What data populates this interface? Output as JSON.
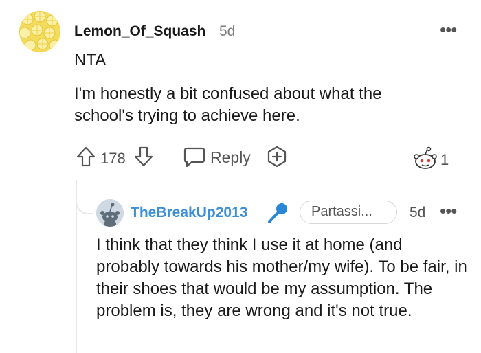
{
  "comment": {
    "username": "Lemon_Of_Squash",
    "time": "5d",
    "lines": [
      "NTA",
      "I'm honestly a bit confused about what the",
      "school's trying to achieve here."
    ],
    "votes": "178",
    "reply_label": "Reply",
    "award_count": "1",
    "more": "•••"
  },
  "reply": {
    "username": "TheBreakUp2013",
    "flair": "Partassi...",
    "time": "5d",
    "more": "•••",
    "text": "I think that they think I use it at home (and probably towards his mother/my wife). To be fair, in their shoes that would be my assumption. The problem is, they are wrong and it's not true."
  },
  "icons": {
    "upvote": "upvote-arrow-icon",
    "downvote": "downvote-arrow-icon",
    "reply": "speech-bubble-icon",
    "award": "plus-circle-icon",
    "snoo": "snoo-award-icon",
    "mic": "microphone-icon"
  },
  "colors": {
    "username_blue": "#3a8fd6",
    "mic_blue": "#2a86d6",
    "lemon": "#f2d64a"
  }
}
